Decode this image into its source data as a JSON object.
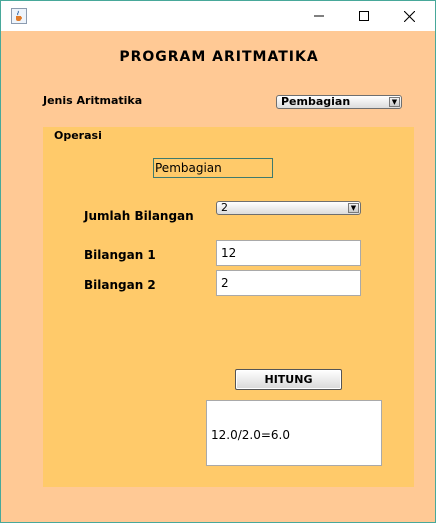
{
  "window": {
    "title": ""
  },
  "header": {
    "title": "PROGRAM ARITMATIKA"
  },
  "jenis": {
    "label": "Jenis Aritmatika",
    "selected": "Pembagian"
  },
  "operasi": {
    "title": "Operasi",
    "operation_display": "Pembagian",
    "jumlah_label": "Jumlah Bilangan",
    "jumlah_selected": "2",
    "bilangan1_label": "Bilangan 1",
    "bilangan1_value": "12",
    "bilangan2_label": "Bilangan 2",
    "bilangan2_value": "2",
    "hitung_label": "HITUNG",
    "result": "12.0/2.0=6.0"
  },
  "icons": {
    "app": "java-cup-icon",
    "minimize": "minimize-icon",
    "maximize": "maximize-icon",
    "close": "close-icon",
    "dropdown": "chevron-down-icon"
  },
  "colors": {
    "window_bg": "#ffc995",
    "panel_bg": "#ffca6a",
    "border": "#48a89a"
  }
}
